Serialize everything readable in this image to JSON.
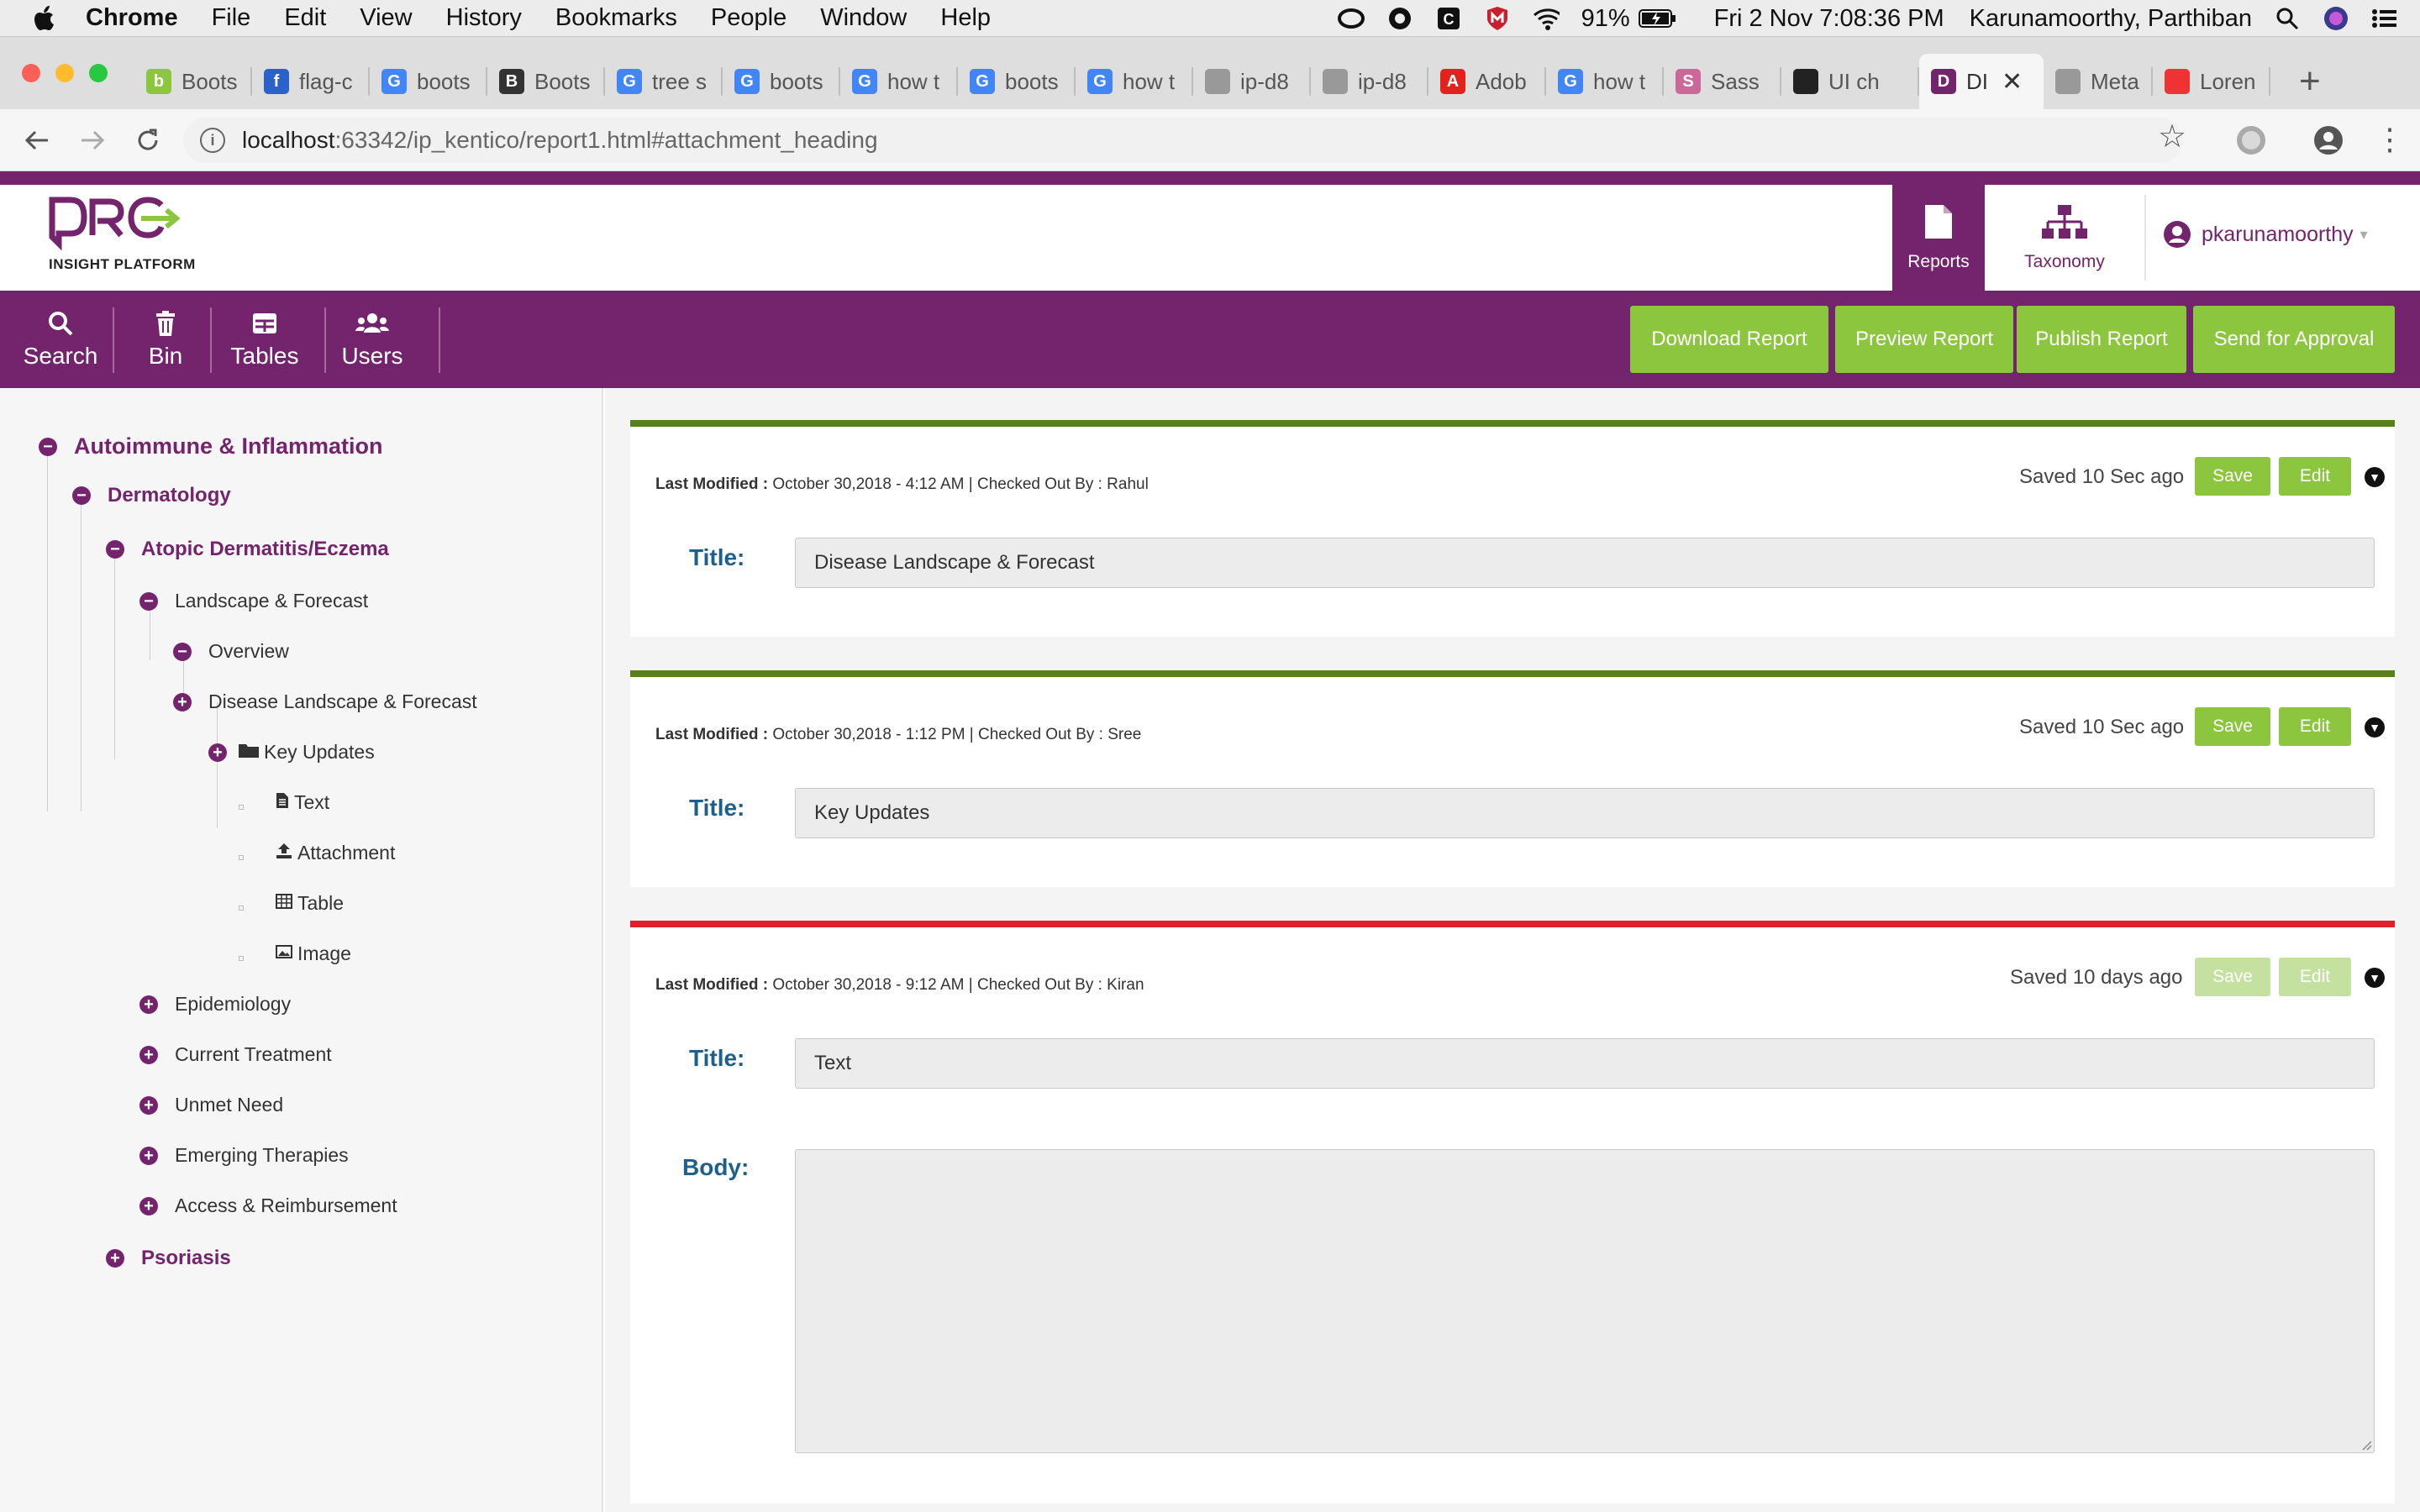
{
  "menubar": {
    "app": "Chrome",
    "items": [
      "File",
      "Edit",
      "View",
      "History",
      "Bookmarks",
      "People",
      "Window",
      "Help"
    ],
    "battery": "91%",
    "datetime": "Fri 2 Nov  7:08:36 PM",
    "username": "Karunamoorthy, Parthiban"
  },
  "tabs": [
    {
      "label": "Boots",
      "fav": "#8cc63f",
      "glyph": "b"
    },
    {
      "label": "flag-c",
      "fav": "#2a62c9",
      "glyph": "f"
    },
    {
      "label": "boots",
      "fav": "#4285f4",
      "glyph": "G"
    },
    {
      "label": "Boots",
      "fav": "#333333",
      "glyph": "B"
    },
    {
      "label": "tree s",
      "fav": "#4285f4",
      "glyph": "G"
    },
    {
      "label": "boots",
      "fav": "#4285f4",
      "glyph": "G"
    },
    {
      "label": "how t",
      "fav": "#4285f4",
      "glyph": "G"
    },
    {
      "label": "boots",
      "fav": "#4285f4",
      "glyph": "G"
    },
    {
      "label": "how t",
      "fav": "#4285f4",
      "glyph": "G"
    },
    {
      "label": "ip-d8",
      "fav": "#999999",
      "glyph": ""
    },
    {
      "label": "ip-d8",
      "fav": "#999999",
      "glyph": ""
    },
    {
      "label": "Adob",
      "fav": "#e3231b",
      "glyph": "A"
    },
    {
      "label": "how t",
      "fav": "#4285f4",
      "glyph": "G"
    },
    {
      "label": "Sass",
      "fav": "#cd6799",
      "glyph": "S"
    },
    {
      "label": "UI ch",
      "fav": "#222222",
      "glyph": ""
    },
    {
      "label": "DI",
      "fav": "#73246c",
      "glyph": "D",
      "active": true
    },
    {
      "label": "Meta",
      "fav": "#999999",
      "glyph": ""
    },
    {
      "label": "Loren",
      "fav": "#e33",
      "glyph": ""
    }
  ],
  "address": {
    "host": "localhost",
    "path": ":63342/ip_kentico/report1.html#attachment_heading"
  },
  "header": {
    "logo_text": "DRG",
    "logo_sub": "INSIGHT PLATFORM",
    "nav_reports": "Reports",
    "nav_taxonomy": "Taxonomy",
    "user": "pkarunamoorthy"
  },
  "toolbar": {
    "search": "Search",
    "bin": "Bin",
    "tables": "Tables",
    "users": "Users",
    "download": "Download Report",
    "preview": "Preview Report",
    "publish": "Publish Report",
    "approval": "Send for Approval"
  },
  "tree": {
    "root": "Autoimmune & Inflammation",
    "l2": "Dermatology",
    "l3": "Atopic Dermatitis/Eczema",
    "landscape": "Landscape & Forecast",
    "overview": "Overview",
    "disease": "Disease Landscape & Forecast",
    "keyupdates": "Key Updates",
    "text": "Text",
    "attachment": "Attachment",
    "table": "Table",
    "image": "Image",
    "epi": "Epidemiology",
    "current": "Current Treatment",
    "unmet": "Unmet Need",
    "emerging": "Emerging Therapies",
    "access": "Access & Reimbursement",
    "psoriasis": "Psoriasis"
  },
  "cards": [
    {
      "bar": "#5a7f1e",
      "meta_label": "Last Modified :",
      "meta": " October 30,2018 - 4:12 AM | Checked Out By : Rahul",
      "saved": "Saved 10 Sec ago",
      "save": "Save",
      "edit": "Edit",
      "title_label": "Title:",
      "title": "Disease Landscape & Forecast"
    },
    {
      "bar": "#5a7f1e",
      "meta_label": "Last Modified :",
      "meta": " October 30,2018 - 1:12 PM | Checked Out By : Sree",
      "saved": "Saved 10 Sec ago",
      "save": "Save",
      "edit": "Edit",
      "title_label": "Title:",
      "title": "Key Updates"
    },
    {
      "bar": "#e0202b",
      "meta_label": "Last Modified :",
      "meta": " October 30,2018 - 9:12 AM | Checked Out By : Kiran",
      "saved": "Saved 10 days ago",
      "save": "Save",
      "edit": "Edit",
      "title_label": "Title:",
      "title": "Text",
      "body_label": "Body:",
      "body": ""
    }
  ]
}
